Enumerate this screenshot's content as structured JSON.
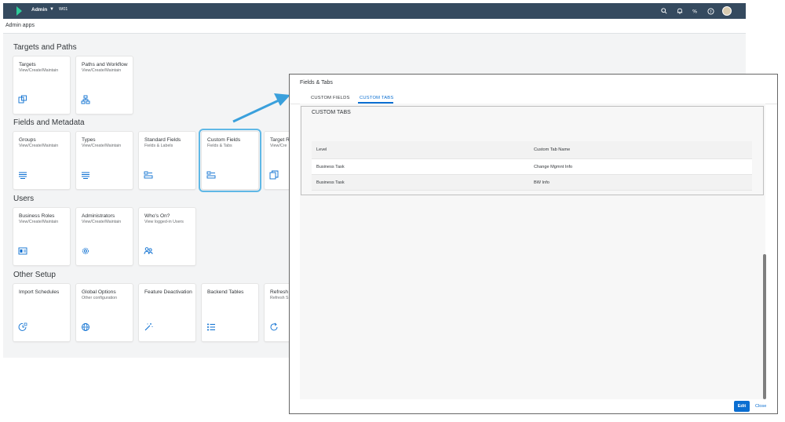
{
  "shell": {
    "app_title": "Admin",
    "env": "W01",
    "breadcrumb": "Admin apps"
  },
  "sections": [
    {
      "title": "Targets and Paths"
    },
    {
      "title": "Fields and Metadata"
    },
    {
      "title": "Users"
    },
    {
      "title": "Other Setup"
    }
  ],
  "tiles": {
    "targets": {
      "title": "Targets",
      "sub": "View/Create/Maintain",
      "icon": "targets-icon"
    },
    "paths": {
      "title": "Paths and Workflow",
      "sub": "View/Create/Maintain",
      "icon": "workflow-icon"
    },
    "groups": {
      "title": "Groups",
      "sub": "View/Create/Maintain",
      "icon": "list-icon"
    },
    "types": {
      "title": "Types",
      "sub": "View/Create/Maintain",
      "icon": "list-icon"
    },
    "standard_fields": {
      "title": "Standard Fields",
      "sub": "Fields & Labels",
      "icon": "fields-icon"
    },
    "custom_fields": {
      "title": "Custom Fields",
      "sub": "Fields & Tabs",
      "icon": "fields-icon"
    },
    "target_r": {
      "title": "Target R",
      "sub": "View/Cre",
      "icon": "copy-icon"
    },
    "business_roles": {
      "title": "Business Roles",
      "sub": "View/Create/Maintain",
      "icon": "id-card-icon"
    },
    "administrators": {
      "title": "Administrators",
      "sub": "View/Create/Maintain",
      "icon": "admin-gear-icon"
    },
    "whos_on": {
      "title": "Who's On?",
      "sub": "View logged-in Users",
      "icon": "users-icon"
    },
    "import_schedules": {
      "title": "Import Schedules",
      "sub": "",
      "icon": "schedule-icon"
    },
    "global_options": {
      "title": "Global Options",
      "sub": "Other configuration",
      "icon": "globe-icon"
    },
    "feature_deactivation": {
      "title": "Feature Deactivation",
      "sub": "",
      "icon": "magic-wand-icon"
    },
    "backend_tables": {
      "title": "Backend Tables",
      "sub": "",
      "icon": "bulleted-list-icon"
    },
    "refresh": {
      "title": "Refresh",
      "sub": "Refresh S",
      "icon": "refresh-icon"
    }
  },
  "dialog": {
    "title": "Fields & Tabs",
    "tabs": [
      {
        "label": "CUSTOM FIELDS",
        "active": false
      },
      {
        "label": "CUSTOM TABS",
        "active": true
      }
    ],
    "panel_title": "CUSTOM TABS",
    "table": {
      "headers": [
        "Level",
        "Custom Tab Name"
      ],
      "rows": [
        [
          "Business Task",
          "Change Mgmnt Info"
        ],
        [
          "Business Task",
          "BW Info"
        ]
      ]
    },
    "edit_label": "Edit",
    "close_label": "Close"
  },
  "colors": {
    "shell_bar": "#354a5f",
    "accent": "#0a6ed1",
    "selection": "#5fb8e6"
  }
}
